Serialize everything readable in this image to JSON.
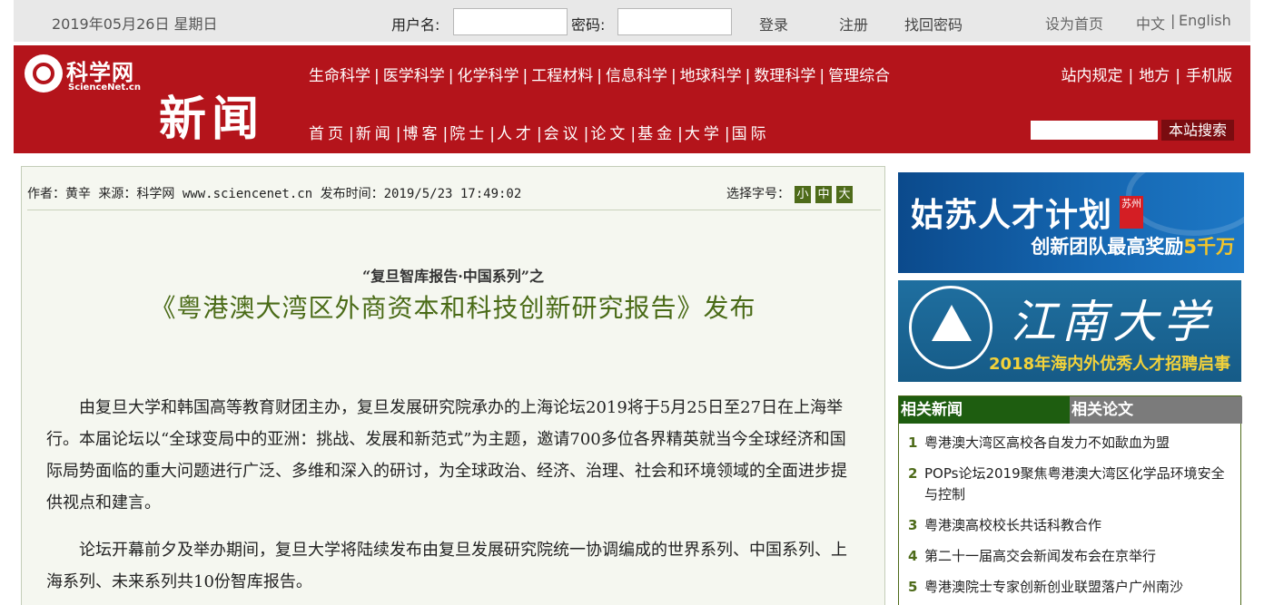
{
  "topbar": {
    "date": "2019年05月26日 星期日",
    "username_label": "用户名:",
    "password_label": "密码:",
    "login": "登录",
    "register": "注册",
    "recover": "找回密码",
    "homepage": "设为首页",
    "lang_cn": "中文",
    "lang_sep": "|",
    "lang_en": "English"
  },
  "header": {
    "logo_cn": "科学网",
    "logo_en": "ScienceNet.cn",
    "section_title": "新闻",
    "categories": [
      "生命科学",
      "医学科学",
      "化学科学",
      "工程材料",
      "信息科学",
      "地球科学",
      "数理科学",
      "管理综合"
    ],
    "main_nav": [
      "首页",
      "新闻",
      "博客",
      "院士",
      "人才",
      "会议",
      "论文",
      "基金",
      "大学",
      "国际"
    ],
    "right_links": [
      "站内规定",
      "地方",
      "手机版"
    ],
    "search_button": "本站搜索"
  },
  "article": {
    "meta": "作者：黄辛 来源：科学网 www.sciencenet.cn 发布时间：2019/5/23 17:49:02",
    "font_select_label": "选择字号：",
    "font_sizes": [
      "小",
      "中",
      "大"
    ],
    "subtitle": "“复旦智库报告·中国系列”之",
    "headline": "《粤港澳大湾区外商资本和科技创新研究报告》发布",
    "paragraphs": [
      "由复旦大学和韩国高等教育财团主办，复旦发展研究院承办的上海论坛2019将于5月25日至27日在上海举行。本届论坛以“全球变局中的亚洲：挑战、发展和新范式”为主题，邀请700多位各界精英就当今全球经济和国际局势面临的重大问题进行广泛、多维和深入的研讨，为全球政治、经济、治理、社会和环境领域的全面进步提供视点和建言。",
      "论坛开幕前夕及举办期间，复旦大学将陆续发布由复旦发展研究院统一协调编成的世界系列、中国系列、上海系列、未来系列共10份智库报告。"
    ]
  },
  "banners": {
    "b1_title": "姑苏人才计划",
    "b1_badge": "苏州",
    "b1_sub_prefix": "创新团队最高奖励",
    "b1_sub_highlight": "5千万",
    "b2_title": "江南大学",
    "b2_sub": "2018年海内外优秀人才招聘启事"
  },
  "related": {
    "tab_news": "相关新闻",
    "tab_papers": "相关论文",
    "items": [
      {
        "num": "1",
        "text": "粤港澳大湾区高校各自发力不如歃血为盟"
      },
      {
        "num": "2",
        "text": "POPs论坛2019聚焦粤港澳大湾区化学品环境安全与控制"
      },
      {
        "num": "3",
        "text": "粤港澳高校校长共话科教合作"
      },
      {
        "num": "4",
        "text": "第二十一届高交会新闻发布会在京举行"
      },
      {
        "num": "5",
        "text": "粤港澳院士专家创新创业联盟落户广州南沙"
      }
    ]
  }
}
